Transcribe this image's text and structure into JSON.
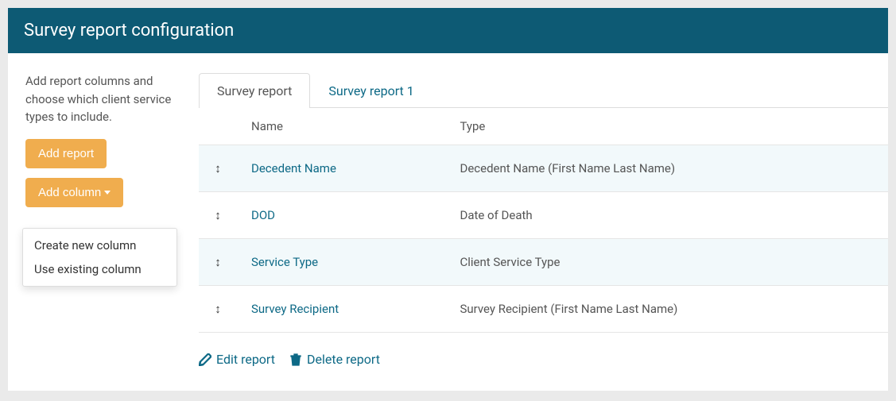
{
  "header": {
    "title": "Survey report configuration"
  },
  "sidebar": {
    "helper": "Add report columns and choose which client service types to include.",
    "add_report_label": "Add report",
    "add_column_label": "Add column",
    "dropdown": {
      "create_new": "Create new column",
      "use_existing": "Use existing column"
    }
  },
  "tabs": [
    {
      "label": "Survey report",
      "active": true
    },
    {
      "label": "Survey report 1",
      "active": false
    }
  ],
  "table": {
    "columns": {
      "name": "Name",
      "type": "Type"
    },
    "rows": [
      {
        "name": "Decedent Name",
        "type": "Decedent Name (First Name Last Name)",
        "striped": true
      },
      {
        "name": "DOD",
        "type": "Date of Death",
        "striped": false
      },
      {
        "name": "Service Type",
        "type": "Client Service Type",
        "striped": true
      },
      {
        "name": "Survey Recipient",
        "type": "Survey Recipient (First Name Last Name)",
        "striped": false
      }
    ]
  },
  "actions": {
    "edit": "Edit report",
    "delete": "Delete report"
  }
}
